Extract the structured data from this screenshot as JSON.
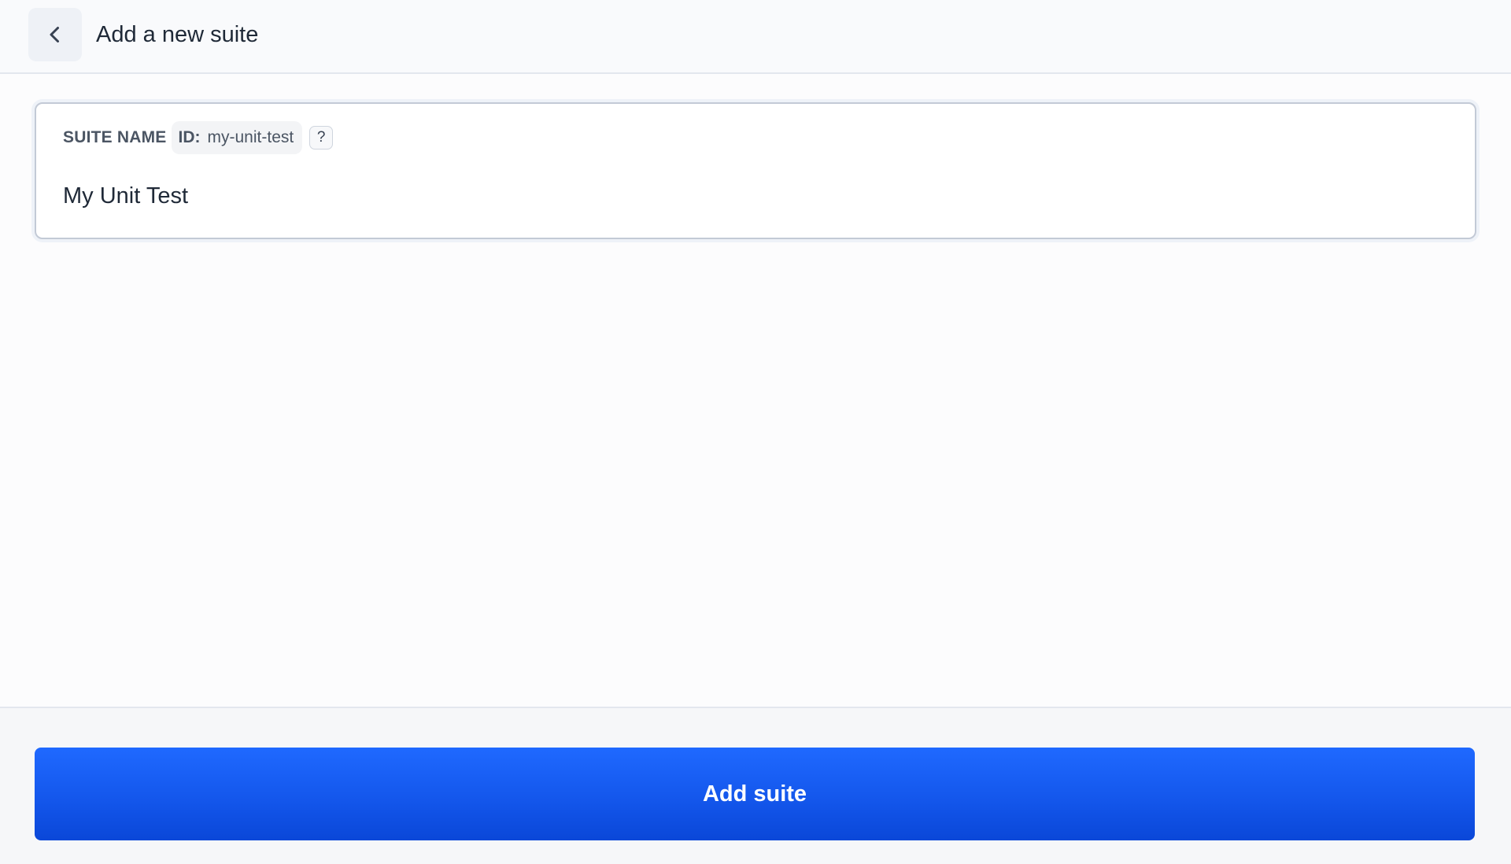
{
  "header": {
    "back_icon": "chevron-left-icon",
    "title": "Add a new suite"
  },
  "form": {
    "suite_name": {
      "label": "SUITE NAME",
      "id_prefix": "ID:",
      "id_value": "my-unit-test",
      "help_label": "?",
      "value": "My Unit Test",
      "placeholder": ""
    }
  },
  "footer": {
    "submit_label": "Add suite"
  },
  "colors": {
    "accent": "#1457ec",
    "caret": "#2563eb"
  }
}
